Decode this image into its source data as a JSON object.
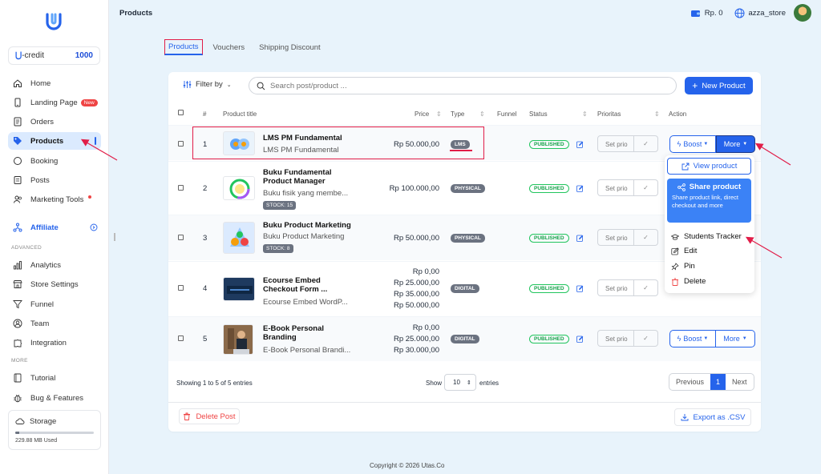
{
  "sidebar": {
    "credit_label": "-credit",
    "credit_value": "1000",
    "items": [
      {
        "label": "Home"
      },
      {
        "label": "Landing Page",
        "badge": "New"
      },
      {
        "label": "Orders"
      },
      {
        "label": "Products"
      },
      {
        "label": "Booking"
      },
      {
        "label": "Posts"
      },
      {
        "label": "Marketing Tools"
      },
      {
        "label": "Affiliate"
      }
    ],
    "advanced_label": "ADVANCED",
    "advanced_items": [
      {
        "label": "Analytics"
      },
      {
        "label": "Store Settings"
      },
      {
        "label": "Funnel"
      },
      {
        "label": "Team"
      },
      {
        "label": "Integration"
      }
    ],
    "more_label": "MORE",
    "more_items": [
      {
        "label": "Tutorial"
      },
      {
        "label": "Bug & Features"
      }
    ],
    "storage": {
      "label": "Storage",
      "used": "229.88 MB Used",
      "fraction": 0.05
    }
  },
  "topbar": {
    "title": "Products",
    "balance": "Rp. 0",
    "store": "azza_store"
  },
  "tabs": [
    "Products",
    "Vouchers",
    "Shipping Discount"
  ],
  "toolbar": {
    "filter_label": "Filter by",
    "search_placeholder": "Search post/product ...",
    "new_product_label": "New Product"
  },
  "table": {
    "headers": {
      "no": "#",
      "title": "Product title",
      "price": "Price",
      "type": "Type",
      "funnel": "Funnel",
      "status": "Status",
      "priority": "Prioritas",
      "action": "Action"
    },
    "prio_placeholder": "Set prio",
    "boost_label": "Boost",
    "more_label": "More",
    "rows": [
      {
        "no": "1",
        "title": "LMS PM Fundamental",
        "subtitle": "LMS PM Fundamental",
        "prices": [
          "Rp 50.000,00"
        ],
        "type": "LMS",
        "status": "PUBLISHED",
        "stock": ""
      },
      {
        "no": "2",
        "title": "Buku Fundamental Product Manager",
        "subtitle": "Buku fisik yang membe...",
        "prices": [
          "Rp 100.000,00"
        ],
        "type": "PHYSICAL",
        "status": "PUBLISHED",
        "stock": "STOCK: 15"
      },
      {
        "no": "3",
        "title": "Buku Product Marketing",
        "subtitle": "Buku Product Marketing",
        "prices": [
          "Rp 50.000,00"
        ],
        "type": "PHYSICAL",
        "status": "PUBLISHED",
        "stock": "STOCK: 8"
      },
      {
        "no": "4",
        "title": "Ecourse Embed Checkout Form ...",
        "subtitle": "Ecourse Embed WordP...",
        "prices": [
          "Rp 0,00",
          "Rp 25.000,00",
          "Rp 35.000,00",
          "Rp 50.000,00"
        ],
        "type": "DIGITAL",
        "status": "PUBLISHED",
        "stock": ""
      },
      {
        "no": "5",
        "title": "E-Book Personal Branding",
        "subtitle": "E-Book Personal Brandi...",
        "prices": [
          "Rp 0,00",
          "Rp 25.000,00",
          "Rp 30.000,00"
        ],
        "type": "DIGITAL",
        "status": "PUBLISHED",
        "stock": ""
      }
    ]
  },
  "dropdown": {
    "view": "View product",
    "share_title": "Share product",
    "share_desc": "Share product link, direct checkout and more",
    "students": "Students Tracker",
    "edit": "Edit",
    "pin": "Pin",
    "delete": "Delete"
  },
  "footer": {
    "showing": "Showing 1 to 5 of 5 entries",
    "show": "Show",
    "per_page": "10",
    "entries": "entries",
    "previous": "Previous",
    "page": "1",
    "next": "Next",
    "delete_post": "Delete Post",
    "export": "Export as .CSV"
  },
  "copyright": "Copyright © 2026 Utas.Co",
  "colors": {
    "accent": "#2563eb",
    "danger": "#ef4444",
    "success": "#16a34a",
    "highlight": "#e11d48"
  }
}
